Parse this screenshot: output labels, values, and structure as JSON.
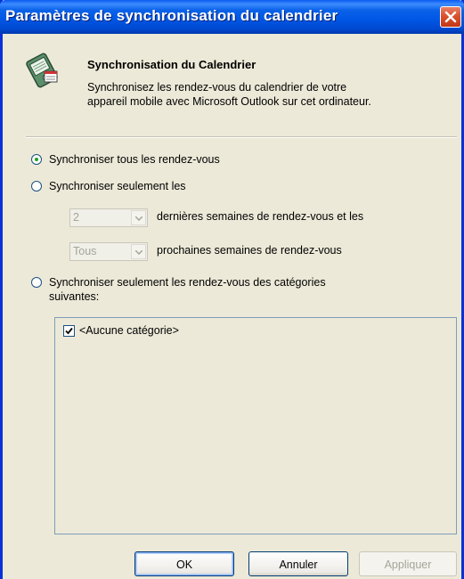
{
  "window": {
    "title": "Paramètres de synchronisation du calendrier"
  },
  "header": {
    "title": "Synchronisation du Calendrier",
    "description_line1": "Synchronisez les rendez-vous du calendrier de votre",
    "description_line2": "appareil mobile avec Microsoft Outlook sur cet ordinateur."
  },
  "options": {
    "all_label": "Synchroniser tous les rendez-vous",
    "only_label": "Synchroniser seulement les",
    "past_weeks_value": "2",
    "past_weeks_text": "dernières semaines de rendez-vous et les",
    "future_weeks_value": "Tous",
    "future_weeks_text": "prochaines semaines de rendez-vous",
    "categories_label_line1": "Synchroniser seulement les rendez-vous des catégories",
    "categories_label_line2": "suivantes:",
    "selected": "all"
  },
  "categories": {
    "items": [
      {
        "label": "<Aucune catégorie>",
        "checked": true
      }
    ]
  },
  "buttons": {
    "ok": "OK",
    "cancel": "Annuler",
    "apply": "Appliquer"
  },
  "colors": {
    "titlebar": "#0058e6",
    "close": "#d9522d",
    "dialog_bg": "#ece9d8"
  }
}
